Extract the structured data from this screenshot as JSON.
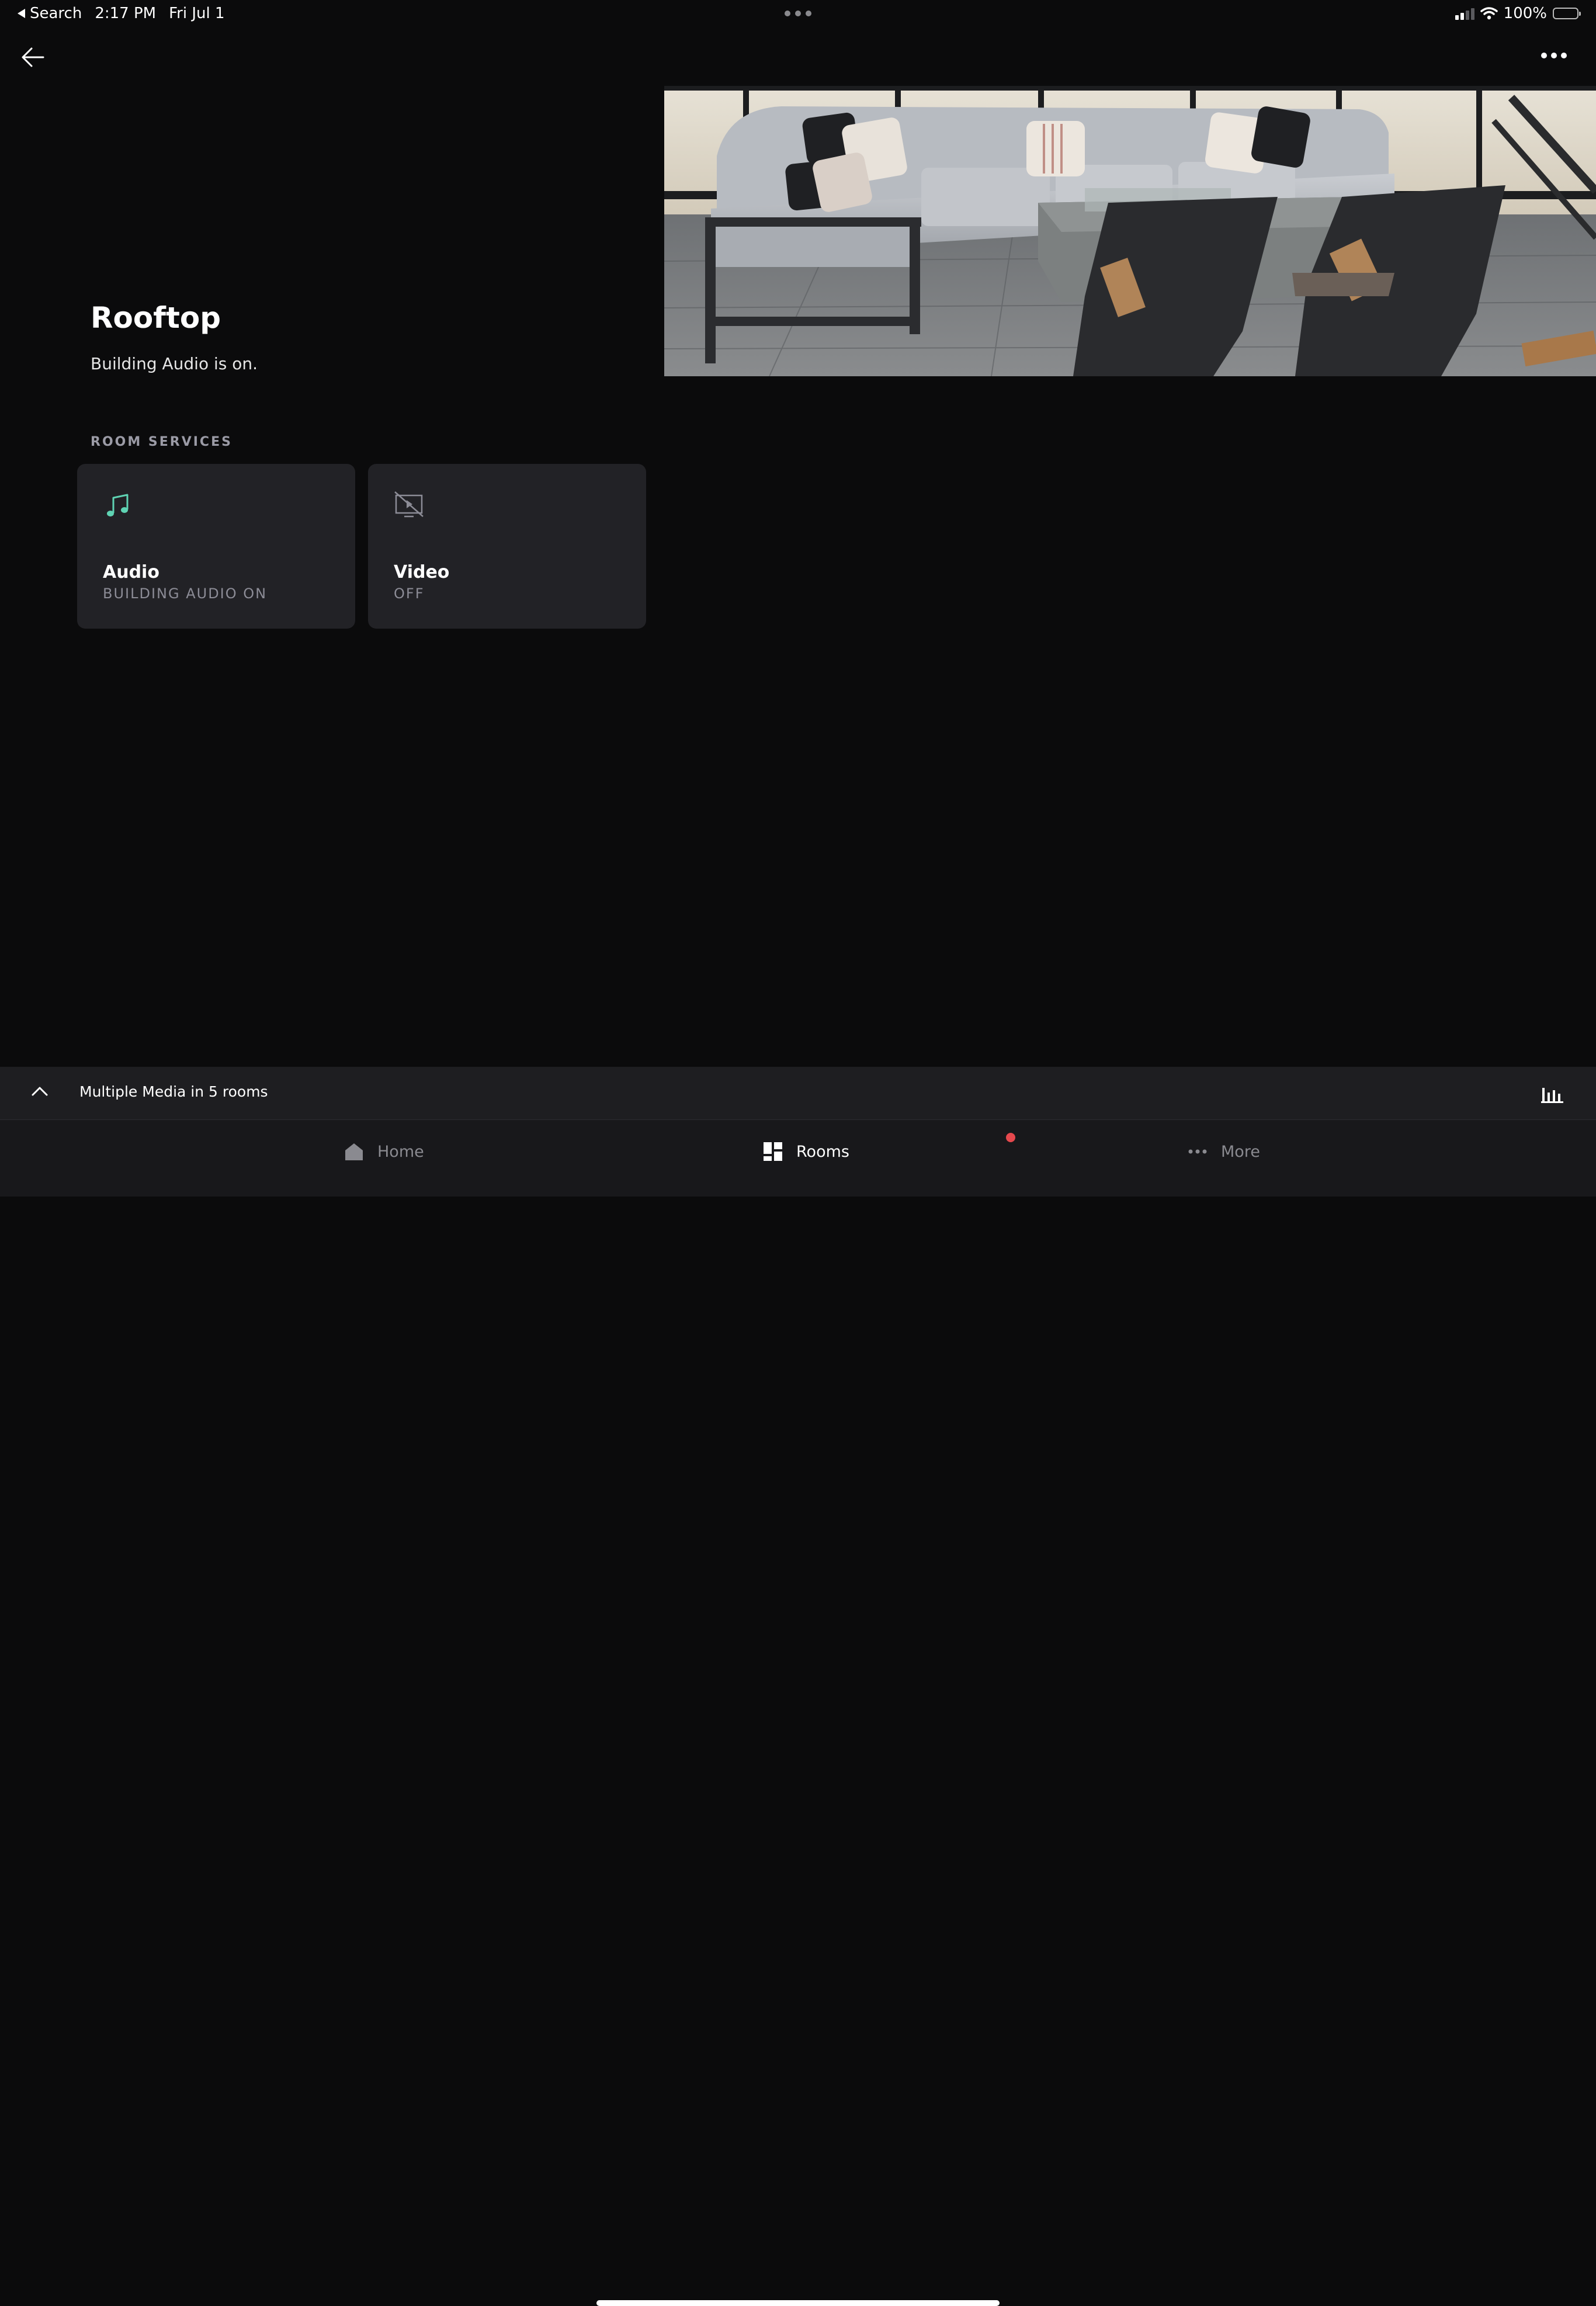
{
  "status_bar": {
    "back_label": "Search",
    "time": "2:17 PM",
    "date": "Fri Jul 1",
    "battery": "100%"
  },
  "room": {
    "title": "Rooftop",
    "subtitle": "Building Audio is on.",
    "section_label": "ROOM SERVICES"
  },
  "services": [
    {
      "title": "Audio",
      "status": "BUILDING AUDIO ON",
      "icon": "music-note-icon",
      "icon_color": "#5fd3b3"
    },
    {
      "title": "Video",
      "status": "OFF",
      "icon": "video-off-icon",
      "icon_color": "#8c8c96"
    }
  ],
  "media_bar": {
    "text": "Multiple Media in 5 rooms"
  },
  "tabs": [
    {
      "label": "Home",
      "icon": "home-icon"
    },
    {
      "label": "Rooms",
      "icon": "rooms-grid-icon"
    },
    {
      "label": "More",
      "icon": "more-dots-icon"
    }
  ],
  "colors": {
    "background": "#0b0b0c",
    "card": "#222226",
    "accent": "#5fd3b3",
    "notification": "#e5484d"
  }
}
